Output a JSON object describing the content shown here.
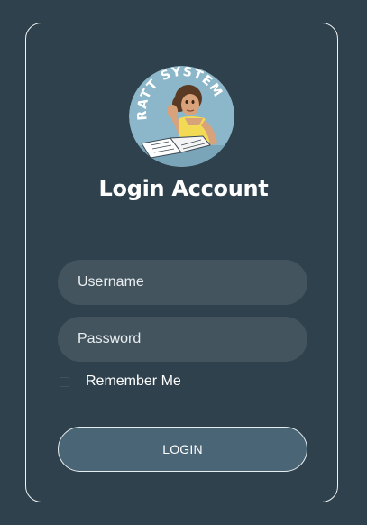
{
  "logo": {
    "name": "ratt-system-logo",
    "text": "RATT SYSTEM",
    "colors": {
      "background": "#8cb6c9",
      "text": "#ffffff",
      "shirt": "#f2da55",
      "hair": "#5a3a22",
      "skin": "#d8a27a"
    }
  },
  "title": "Login Account",
  "form": {
    "username_placeholder": "Username",
    "password_placeholder": "Password",
    "remember_label": "Remember Me",
    "remember_checked": false,
    "login_label": "LOGIN"
  },
  "colors": {
    "page_background": "#2e414c",
    "input_background": "#43545e",
    "button_background": "#4a6676",
    "card_border": "#f1f3f4"
  }
}
